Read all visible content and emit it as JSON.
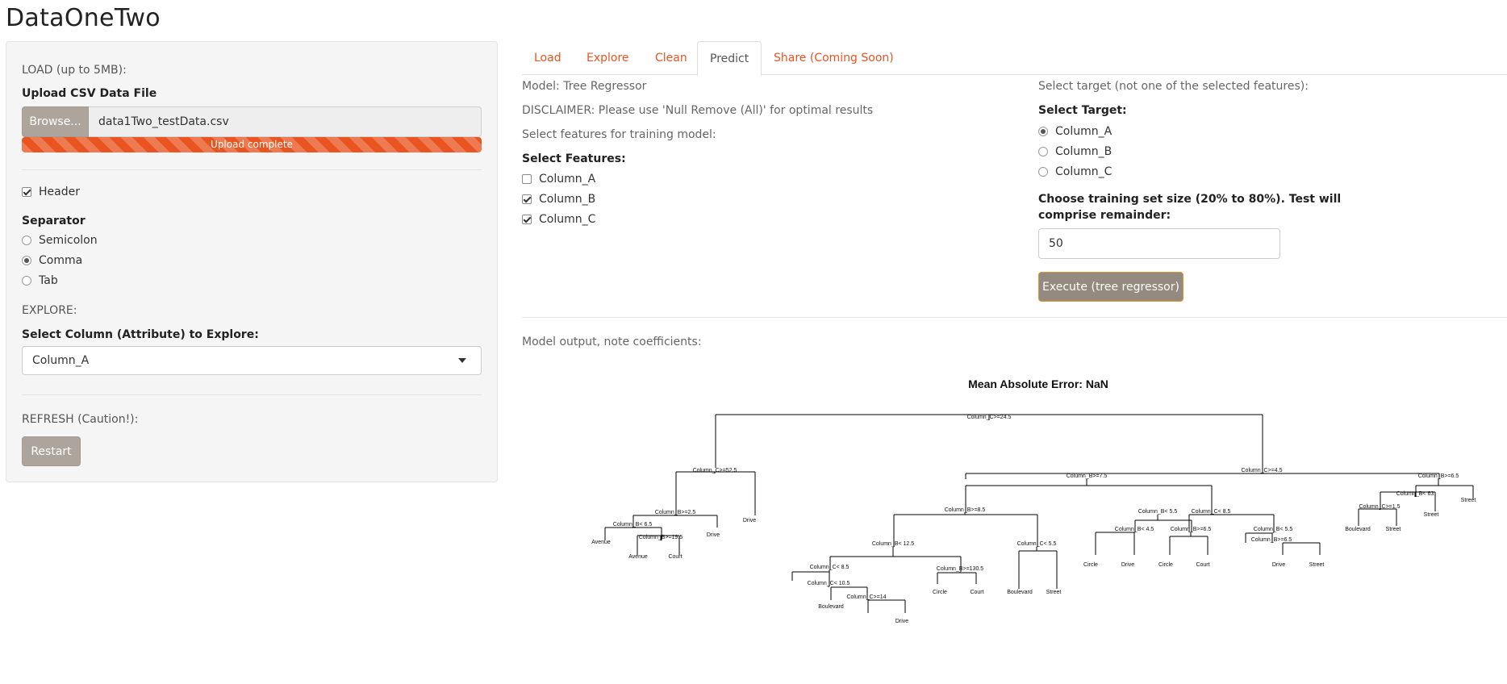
{
  "app": {
    "title": "DataOneTwo"
  },
  "sidebar": {
    "load_heading": "LOAD (up to 5MB):",
    "upload_label": "Upload CSV Data File",
    "browse_label": "Browse...",
    "file_name": "data1Two_testData.csv",
    "upload_progress": {
      "text": "Upload complete",
      "percent": 100,
      "color": "#e95420"
    },
    "header_checkbox": {
      "label": "Header",
      "checked": true
    },
    "separator": {
      "label": "Separator",
      "options": [
        {
          "label": "Semicolon",
          "checked": false
        },
        {
          "label": "Comma",
          "checked": true
        },
        {
          "label": "Tab",
          "checked": false
        }
      ]
    },
    "explore_heading": "EXPLORE:",
    "explore_select_label": "Select Column (Attribute) to Explore:",
    "explore_select_value": "Column_A",
    "refresh_heading": "REFRESH (Caution!):",
    "restart_label": "Restart"
  },
  "tabs": [
    {
      "label": "Load",
      "active": false
    },
    {
      "label": "Explore",
      "active": false
    },
    {
      "label": "Clean",
      "active": false
    },
    {
      "label": "Predict",
      "active": true
    },
    {
      "label": "Share (Coming Soon)",
      "active": false
    }
  ],
  "predict": {
    "model_text": "Model: Tree Regressor",
    "disclaimer": "DISCLAIMER: Please use 'Null Remove (All)' for optimal results",
    "features_prompt": "Select features for training model:",
    "features_label": "Select Features:",
    "features": [
      {
        "label": "Column_A",
        "checked": false
      },
      {
        "label": "Column_B",
        "checked": true
      },
      {
        "label": "Column_C",
        "checked": true
      }
    ],
    "target_prompt": "Select target (not one of the selected features):",
    "target_label": "Select Target:",
    "targets": [
      {
        "label": "Column_A",
        "checked": true
      },
      {
        "label": "Column_B",
        "checked": false
      },
      {
        "label": "Column_C",
        "checked": false
      }
    ],
    "train_size_label_line1": "Choose training set size (20% to 80%). Test will",
    "train_size_label_line2": "comprise remainder:",
    "train_size_value": "50",
    "execute_label": "Execute (tree regressor)",
    "output_label": "Model output, note coefficients:"
  },
  "tree": {
    "title": "Mean Absolute Error:  NaN",
    "split_labels": {
      "n1": "Column_C>=24.5",
      "n2": "Column_C>=52.5",
      "n3": "Column_C>=4.5",
      "n4": "Column_B>=2.5",
      "n5": "Column_B< 6.5",
      "n6": "Column_B>=19.5",
      "n7": "Column_B>=7.5",
      "n8": "Column_B>=6.5",
      "n9": "Column_B< 63",
      "n10": "Column_C>=1.5",
      "n11": "Column_B>=8.5",
      "n12": "Column_B< 5.5",
      "n13": "Column_C< 8.5",
      "n14": "Column_B< 12.5",
      "n15": "Column_C< 5.5",
      "n16": "Column_C< 8.5",
      "n17": "Column_B>=130.5",
      "n18": "Column_C< 10.5",
      "n19": "Column_C>=14",
      "n20": "Column_B< 4.5",
      "n21": "Column_B>=6.5",
      "n22": "Column_B< 5.5",
      "n23": "Column_B>=6.5"
    },
    "leaf_labels": {
      "l1": "Avenue",
      "l2": "Avenue",
      "l3": "Court",
      "l4": "Drive",
      "l5": "Drive",
      "l6": "Boulevard",
      "l7": "Drive",
      "l8": "Circle",
      "l9": "Court",
      "l10": "Boulevard",
      "l11": "Street",
      "l12": "Circle",
      "l13": "Drive",
      "l14": "Circle",
      "l15": "Court",
      "l16": "Drive",
      "l17": "Street",
      "l18": "Boulevard",
      "l19": "Street",
      "l20": "Street",
      "l21": "Street"
    }
  }
}
